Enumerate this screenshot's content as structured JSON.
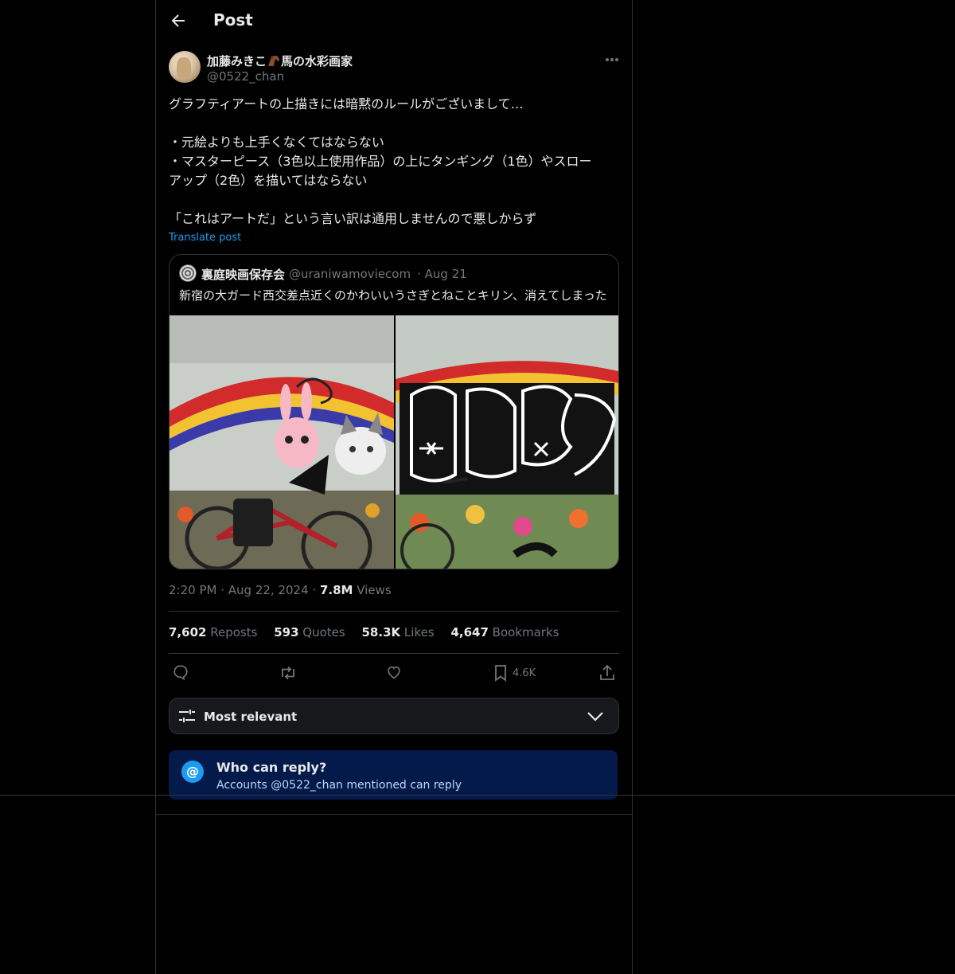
{
  "header": {
    "title": "Post"
  },
  "post": {
    "author_name": "加藤みきこ",
    "author_name_suffix": "馬の水彩画家",
    "author_handle": "@0522_chan",
    "text_lines": [
      "グラフティアートの上描きには暗黙のルールがございまして…",
      "",
      "・元絵よりも上手くなくてはならない",
      "・マスターピース（3色以上使用作品）の上にタンギング（1色）やスロー",
      "アップ（2色）を描いてはならない",
      "",
      "「これはアートだ」という言い訳は通用しませんので悪しからず"
    ],
    "translate_label": "Translate post",
    "time": "2:20 PM",
    "date": "Aug 22, 2024",
    "views_count": "7.8M",
    "views_label": "Views"
  },
  "quote": {
    "name": "裏庭映画保存会",
    "handle": "@uraniwamoviecom",
    "date": "Aug 21",
    "text": "新宿の大ガード西交差点近くのかわいいうさぎとねことキリン、消えてしまった"
  },
  "stats": {
    "reposts_count": "7,602",
    "reposts_label": "Reposts",
    "quotes_count": "593",
    "quotes_label": "Quotes",
    "likes_count": "58.3K",
    "likes_label": "Likes",
    "bookmarks_count": "4,647",
    "bookmarks_label": "Bookmarks"
  },
  "actions": {
    "bookmark_count": "4.6K"
  },
  "sort": {
    "label": "Most relevant"
  },
  "reply_restriction": {
    "title": "Who can reply?",
    "subtitle": "Accounts @0522_chan mentioned can reply"
  },
  "icons": {
    "back": "arrow-left-icon",
    "more": "more-horizontal-icon",
    "reply": "comment-icon",
    "repost": "repost-icon",
    "like": "heart-icon",
    "bookmark": "bookmark-icon",
    "share": "share-icon",
    "sort": "sliders-icon",
    "chevron": "chevron-down-icon",
    "mention": "at-icon"
  },
  "colors": {
    "accent": "#1d9bf0",
    "background": "#000000",
    "text": "#e7e9ea",
    "muted": "#71767b",
    "notice": "#031a4a"
  }
}
